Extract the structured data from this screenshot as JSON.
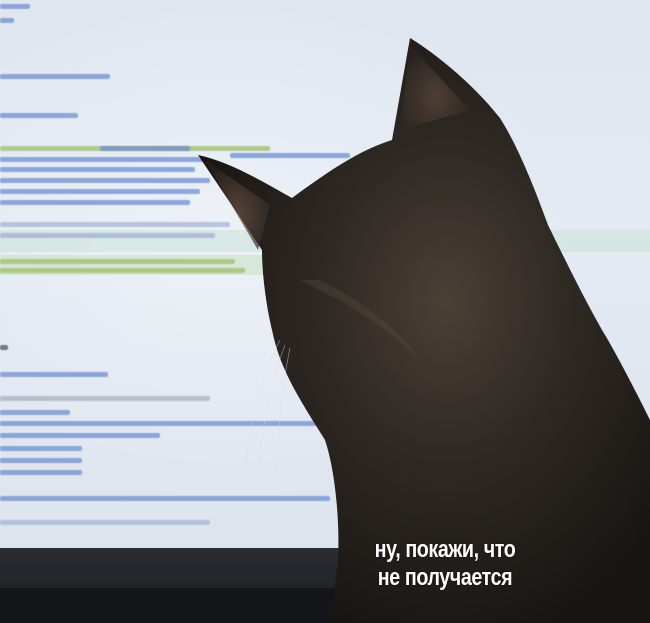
{
  "meme": {
    "caption_line1": "ну, покажи, что",
    "caption_line2": "не получается"
  },
  "colors": {
    "screen": "#e2e8f1",
    "code_green": "#9fbf6a",
    "code_blue": "#6f8fd0",
    "code_dark": "#4a5563",
    "cat_fur": "#2a2520"
  }
}
